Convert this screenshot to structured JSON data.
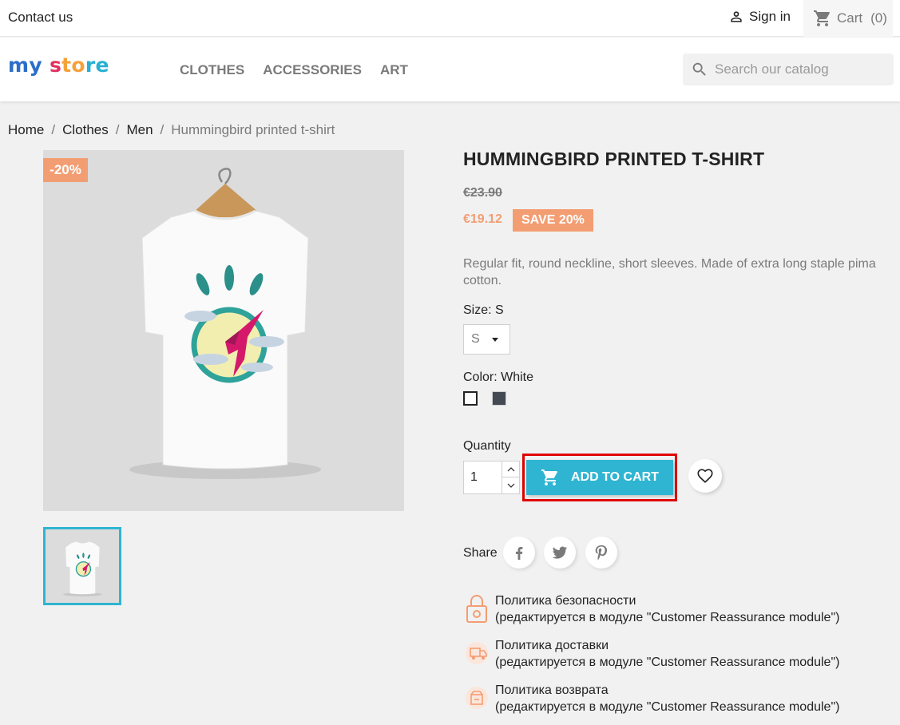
{
  "topbar": {
    "contact": "Contact us",
    "signin": "Sign in",
    "cart_label": "Cart",
    "cart_count": "(0)"
  },
  "header": {
    "logo": {
      "part1": "my",
      "part2": " s",
      "part3": "to",
      "part4": "re"
    },
    "nav": [
      "CLOTHES",
      "ACCESSORIES",
      "ART"
    ],
    "search_placeholder": "Search our catalog"
  },
  "breadcrumb": [
    "Home",
    "Clothes",
    "Men",
    "Hummingbird printed t-shirt"
  ],
  "product": {
    "discount_flag": "-20%",
    "title": "HUMMINGBIRD PRINTED T-SHIRT",
    "regular_price": "€23.90",
    "price": "€19.12",
    "save_badge": "SAVE 20%",
    "description": "Regular fit, round neckline, short sleeves. Made of extra long staple pima cotton.",
    "size_label": "Size: S",
    "size_value": "S",
    "color_label": "Color: White",
    "colors": [
      "#ffffff",
      "#434a54"
    ],
    "quantity_label": "Quantity",
    "quantity_value": "1",
    "add_to_cart": "ADD TO CART",
    "share_label": "Share"
  },
  "reassurance": [
    {
      "title": "Политика безопасности",
      "subtitle": "(редактируется в модуле \"Customer Reassurance module\")",
      "icon": "lock-icon"
    },
    {
      "title": "Политика доставки",
      "subtitle": "(редактируется в модуле \"Customer Reassurance module\")",
      "icon": "truck-icon"
    },
    {
      "title": "Политика возврата",
      "subtitle": "(редактируется в модуле \"Customer Reassurance module\")",
      "icon": "return-box-icon"
    }
  ],
  "colors": {
    "accent": "#2fb5d2",
    "discount": "#f39d72",
    "highlight": "#e00000"
  }
}
